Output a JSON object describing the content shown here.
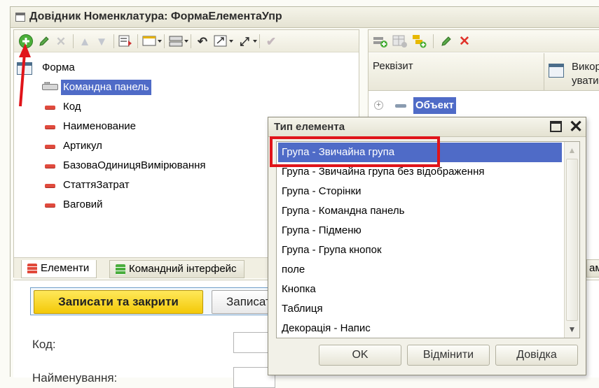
{
  "window": {
    "title": "Довідник Номенклатура: ФормаЕлементаУпр"
  },
  "left_toolbar": {
    "icons": [
      "add-icon",
      "edit-pencil-icon",
      "delete-x-icon",
      "move-up-icon",
      "move-down-icon",
      "properties-icon",
      "display-dropdown-icon",
      "group-dropdown-icon",
      "restore-icon",
      "resize-dropdown-icon",
      "expand-dropdown-icon",
      "check-icon"
    ]
  },
  "tree": {
    "root": "Форма",
    "items": [
      {
        "label": "Командна панель",
        "type": "command-panel",
        "selected": true
      },
      {
        "label": "Код",
        "type": "field"
      },
      {
        "label": "Наименование",
        "type": "field"
      },
      {
        "label": "Артикул",
        "type": "field"
      },
      {
        "label": "БазоваОдиницяВимірювання",
        "type": "field"
      },
      {
        "label": "СтаттяЗатрат",
        "type": "field"
      },
      {
        "label": "Ваговий",
        "type": "field"
      }
    ]
  },
  "left_tabs": [
    {
      "label": "Елементи",
      "active": true
    },
    {
      "label": "Командний інтерфейс",
      "active": false
    }
  ],
  "right_pane": {
    "col_rekvizyt": "Реквізит",
    "col_vykor": "Викор\nувати",
    "object_label": "Объект",
    "tab_fragment": "ам"
  },
  "preview": {
    "save_close": "Записати та закрити",
    "save": "Записати",
    "kod_label": "Код:",
    "naim_label": "Найменування:"
  },
  "dialog": {
    "title": "Тип елемента",
    "items": [
      "Група - Звичайна група",
      "Група - Звичайна група без відображення",
      "Група - Сторінки",
      "Група - Командна панель",
      "Група - Підменю",
      "Група - Група кнопок",
      "поле",
      "Кнопка",
      "Таблиця",
      "Декорація - Напис"
    ],
    "selected_index": 0,
    "ok": "OK",
    "cancel": "Відмінити",
    "help": "Довідка"
  },
  "colors": {
    "selection": "#4f6bc7",
    "annotation_red": "#e0141a",
    "save_close_yellow": "#f6d21a"
  }
}
